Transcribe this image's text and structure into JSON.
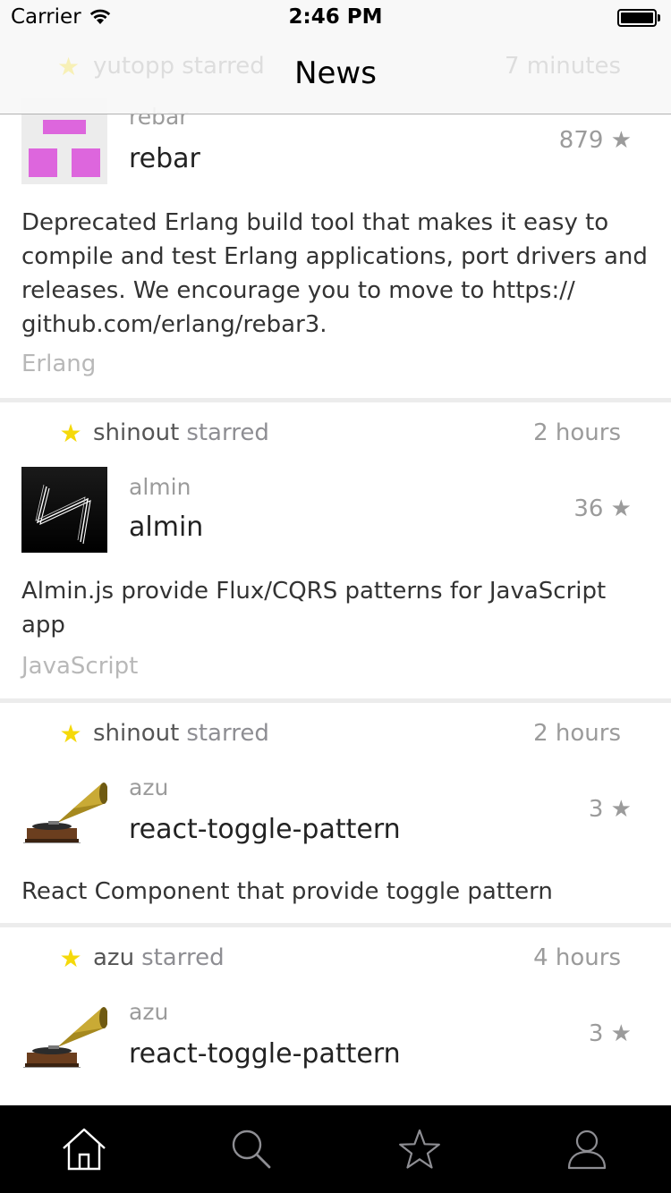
{
  "status_bar": {
    "carrier": "Carrier",
    "time": "2:46 PM"
  },
  "nav": {
    "title": "News",
    "ghost_row": {
      "text": "yutopp starred",
      "time": "7 minutes"
    }
  },
  "feed": [
    {
      "owner": "rebar",
      "name": "rebar",
      "stars": "879 ★",
      "description": "Deprecated Erlang build tool that makes it easy to compile and test Erlang applications, port drivers and releases. We encourage you to move to https:// github.com/erlang/rebar3.",
      "language": "Erlang",
      "avatar": "rebar-logo"
    },
    {
      "actor": "shinout",
      "action": "starred",
      "time": "2 hours",
      "owner": "almin",
      "name": "almin",
      "stars": "36 ★",
      "description": "Almin.js provide Flux/CQRS patterns for JavaScript app",
      "language": "JavaScript",
      "avatar": "almin-logo"
    },
    {
      "actor": "shinout",
      "action": "starred",
      "time": "2 hours",
      "owner": "azu",
      "name": "react-toggle-pattern",
      "stars": "3 ★",
      "description": "React Component that provide toggle pattern",
      "avatar": "gramophone-avatar"
    },
    {
      "actor": "azu",
      "action": "starred",
      "time": "4 hours",
      "owner": "azu",
      "name": "react-toggle-pattern",
      "stars": "3 ★",
      "avatar": "gramophone-avatar"
    }
  ],
  "tabbar": {
    "tabs": [
      {
        "icon": "home-icon",
        "active": true
      },
      {
        "icon": "search-icon",
        "active": false
      },
      {
        "icon": "star-icon",
        "active": false
      },
      {
        "icon": "profile-icon",
        "active": false
      }
    ]
  },
  "colors": {
    "star_yellow": "#f5d90a",
    "muted_text": "#9b9b9b",
    "language_text": "#b8b8b8",
    "separator": "#ececec",
    "tabbar_bg": "#000000",
    "rebar_logo": "#dd66dd"
  }
}
